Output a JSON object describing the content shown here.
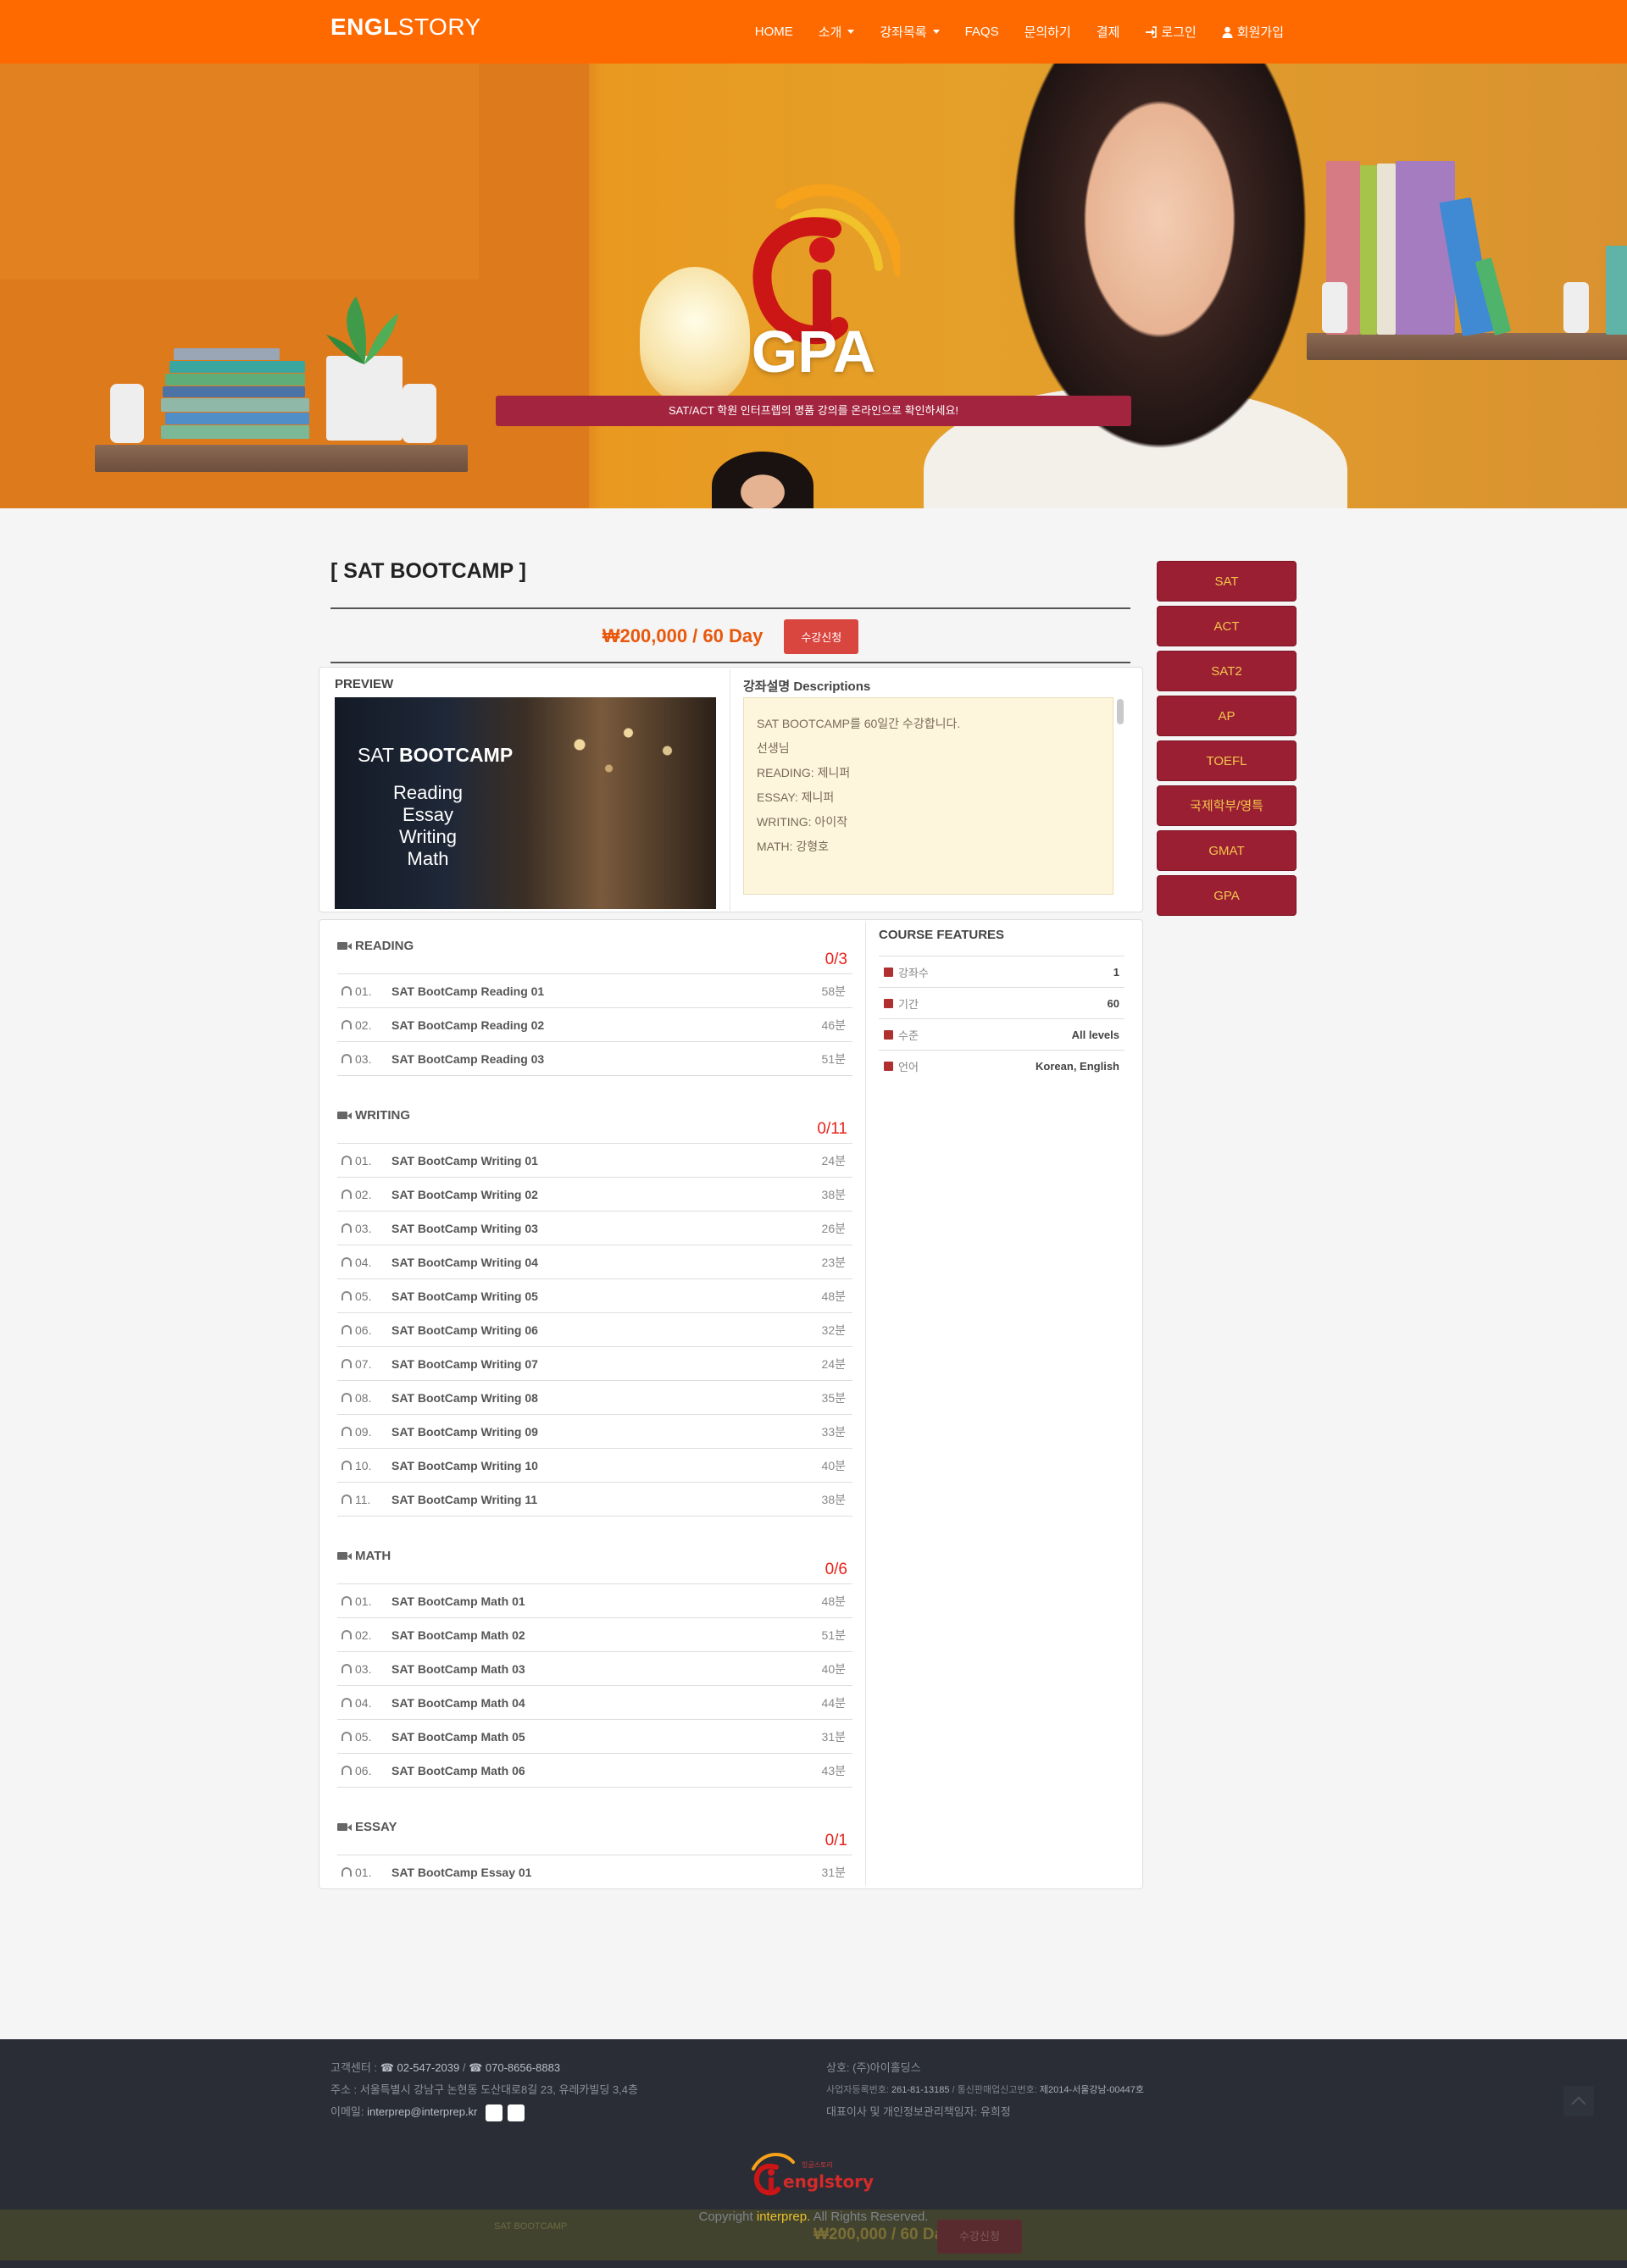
{
  "brand": {
    "bold": "ENGL",
    "light": "STORY"
  },
  "nav": {
    "home": "HOME",
    "intro": "소개",
    "courses": "강좌목록",
    "faqs": "FAQS",
    "inquiry": "문의하기",
    "payment": "결제",
    "login": "로그인",
    "signup": "회원가입"
  },
  "hero": {
    "title": "GPA",
    "subtitle": "SAT/ACT 학원 인터프렙의 명품 강의를 온라인으로 확인하세요!"
  },
  "course": {
    "title": "[ SAT BOOTCAMP ]",
    "price": "₩200,000 / 60 Day",
    "enroll_label": "수강신청"
  },
  "preview": {
    "label": "PREVIEW",
    "image_title_light": "SAT ",
    "image_title_bold": "BOOTCAMP",
    "image_items": [
      "Reading",
      "Essay",
      "Writing",
      "Math"
    ]
  },
  "description": {
    "label": "강좌설명 Descriptions",
    "lines": [
      "SAT BOOTCAMP를 60일간 수강합니다.",
      "",
      "선생님",
      "READING: 제니퍼",
      "ESSAY: 제니퍼",
      "WRITING: 아이작",
      "MATH: 강형호"
    ]
  },
  "sections": [
    {
      "name": "READING",
      "count": "0/3",
      "lessons": [
        {
          "num": "01.",
          "title": "SAT BootCamp Reading 01",
          "dur": "58분"
        },
        {
          "num": "02.",
          "title": "SAT BootCamp Reading 02",
          "dur": "46분"
        },
        {
          "num": "03.",
          "title": "SAT BootCamp Reading 03",
          "dur": "51분"
        }
      ]
    },
    {
      "name": "WRITING",
      "count": "0/11",
      "lessons": [
        {
          "num": "01.",
          "title": "SAT BootCamp Writing 01",
          "dur": "24분"
        },
        {
          "num": "02.",
          "title": "SAT BootCamp Writing 02",
          "dur": "38분"
        },
        {
          "num": "03.",
          "title": "SAT BootCamp Writing 03",
          "dur": "26분"
        },
        {
          "num": "04.",
          "title": "SAT BootCamp Writing 04",
          "dur": "23분"
        },
        {
          "num": "05.",
          "title": "SAT BootCamp Writing 05",
          "dur": "48분"
        },
        {
          "num": "06.",
          "title": "SAT BootCamp Writing 06",
          "dur": "32분"
        },
        {
          "num": "07.",
          "title": "SAT BootCamp Writing 07",
          "dur": "24분"
        },
        {
          "num": "08.",
          "title": "SAT BootCamp Writing 08",
          "dur": "35분"
        },
        {
          "num": "09.",
          "title": "SAT BootCamp Writing 09",
          "dur": "33분"
        },
        {
          "num": "10.",
          "title": "SAT BootCamp Writing 10",
          "dur": "40분"
        },
        {
          "num": "11.",
          "title": "SAT BootCamp Writing 11",
          "dur": "38분"
        }
      ]
    },
    {
      "name": "MATH",
      "count": "0/6",
      "lessons": [
        {
          "num": "01.",
          "title": "SAT BootCamp Math 01",
          "dur": "48분"
        },
        {
          "num": "02.",
          "title": "SAT BootCamp Math 02",
          "dur": "51분"
        },
        {
          "num": "03.",
          "title": "SAT BootCamp Math 03",
          "dur": "40분"
        },
        {
          "num": "04.",
          "title": "SAT BootCamp Math 04",
          "dur": "44분"
        },
        {
          "num": "05.",
          "title": "SAT BootCamp Math 05",
          "dur": "31분"
        },
        {
          "num": "06.",
          "title": "SAT BootCamp Math 06",
          "dur": "43분"
        }
      ]
    },
    {
      "name": "ESSAY",
      "count": "0/1",
      "lessons": [
        {
          "num": "01.",
          "title": "SAT BootCamp Essay 01",
          "dur": "31분"
        }
      ]
    }
  ],
  "features": {
    "title": "COURSE FEATURES",
    "items": [
      {
        "icon": "video-icon",
        "label": "강좌수",
        "value": "1"
      },
      {
        "icon": "hourglass-icon",
        "label": "기간",
        "value": "60"
      },
      {
        "icon": "level-icon",
        "label": "수준",
        "value": "All levels"
      },
      {
        "icon": "language-icon",
        "label": "언어",
        "value": "Korean, English"
      }
    ]
  },
  "sidebar": [
    "SAT",
    "ACT",
    "SAT2",
    "AP",
    "TOEFL",
    "국제학부/영특",
    "GMAT",
    "GPA"
  ],
  "footer": {
    "contact_label": "고객센터 : ",
    "phone1": "☎ 02-547-2039",
    "phone_sep": " / ",
    "phone2": "☎ 070-8656-8883",
    "address_label": "주소 : ",
    "address": "서울특별시 강남구 논현동 도산대로8길 23, 유레카빌딩 3,4층",
    "email_label": "이메일: ",
    "email": "interprep@interprep.kr",
    "company_label": "상호: ",
    "company": "(주)아이홀딩스",
    "biz_no_label": "사업자등록번호: ",
    "biz_no": "261-81-13185",
    "sep": " / ",
    "mail_order_label": "통신판매업신고번호: ",
    "mail_order_no": "제2014-서울강남-00447호",
    "ceo_label": "대표이사 및 개인정보관리책임자: ",
    "ceo": "유희정",
    "logo_small": "잉글스토리",
    "logo_text": "englstory",
    "copyright_prefix": "Copyright ",
    "copyright_brand": "interprep.",
    "copyright_suffix": " All Rights Reserved."
  },
  "sticky": {
    "title": "SAT BOOTCAMP",
    "price": "₩200,000 / 60 Day",
    "enroll_label": "수강신청"
  },
  "colors": {
    "nav": "#ff6a00",
    "accent_price": "#e8580c",
    "enroll": "#d9453f",
    "sidebar_bg": "#9a1f32",
    "sidebar_text": "#f3c64d",
    "count_red": "#e8201a",
    "footer_bg": "#2a2d35"
  }
}
